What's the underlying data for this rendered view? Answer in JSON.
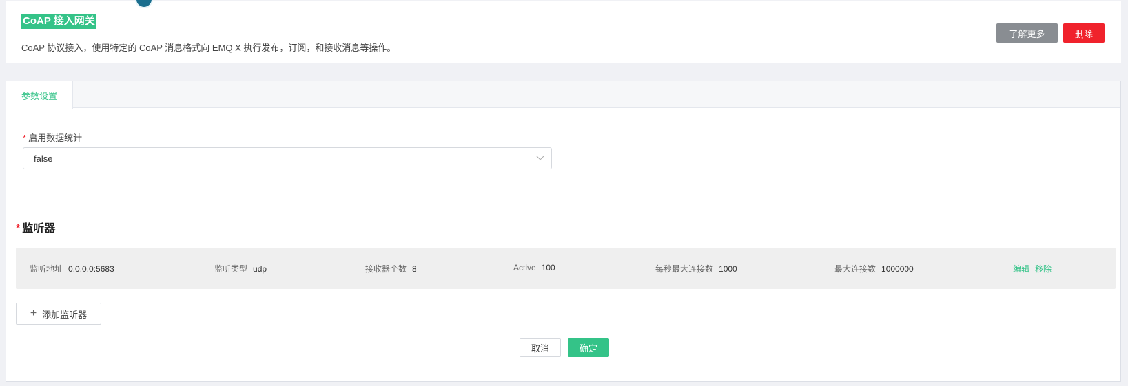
{
  "header": {
    "title": "CoAP 接入网关",
    "description": "CoAP 协议接入，使用特定的 CoAP 消息格式向 EMQ X 执行发布，订阅，和接收消息等操作。",
    "learn_more_label": "了解更多",
    "delete_label": "删除"
  },
  "tabs": [
    {
      "label": "参数设置",
      "active": true
    }
  ],
  "form": {
    "stats_field": {
      "required_mark": "*",
      "label": "启用数据统计",
      "value": "false"
    }
  },
  "listeners": {
    "required_mark": "*",
    "title": "监听器",
    "items": [
      {
        "address_label": "监听地址",
        "address": "0.0.0.0:5683",
        "type_label": "监听类型",
        "type": "udp",
        "acceptors_label": "接收器个数",
        "acceptors": "8",
        "active_label": "Active",
        "active": "100",
        "max_conn_rate_label": "每秒最大连接数",
        "max_conn_rate": "1000",
        "max_connections_label": "最大连接数",
        "max_connections": "1000000",
        "edit_label": "编辑",
        "remove_label": "移除"
      }
    ],
    "add_label": "添加监听器"
  },
  "footer": {
    "cancel_label": "取消",
    "confirm_label": "确定"
  },
  "colors": {
    "accent": "#34c388",
    "danger": "#f0222c",
    "neutral_button": "#898d92"
  }
}
